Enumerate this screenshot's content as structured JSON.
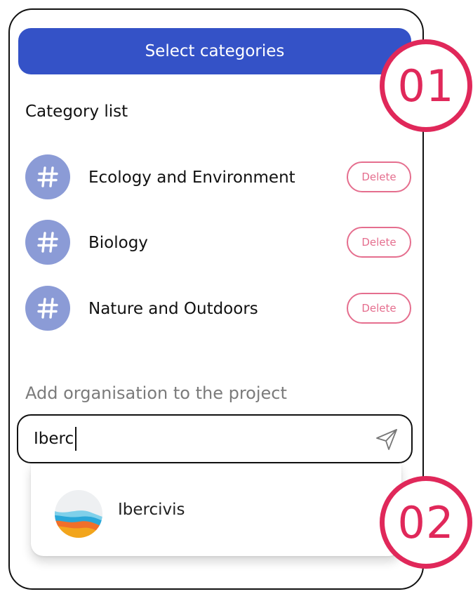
{
  "header": {
    "select_label": "Select categories"
  },
  "category_section": {
    "title": "Category list",
    "items": [
      {
        "icon": "#",
        "label": "Ecology and Environment",
        "action": "Delete"
      },
      {
        "icon": "#",
        "label": "Biology",
        "action": "Delete"
      },
      {
        "icon": "#",
        "label": "Nature and Outdoors",
        "action": "Delete"
      }
    ]
  },
  "organisation_section": {
    "title": "Add organisation to the project",
    "search_value": "Iberc",
    "suggestions": [
      {
        "label": "Ibercivis",
        "logo": "ibercivis-logo"
      }
    ]
  },
  "annotations": {
    "step1": "01",
    "step2": "02"
  },
  "colors": {
    "primary": "#3452c7",
    "icon_bg": "#8b9bd6",
    "delete": "#e56e8e",
    "badge": "#e0285a"
  }
}
